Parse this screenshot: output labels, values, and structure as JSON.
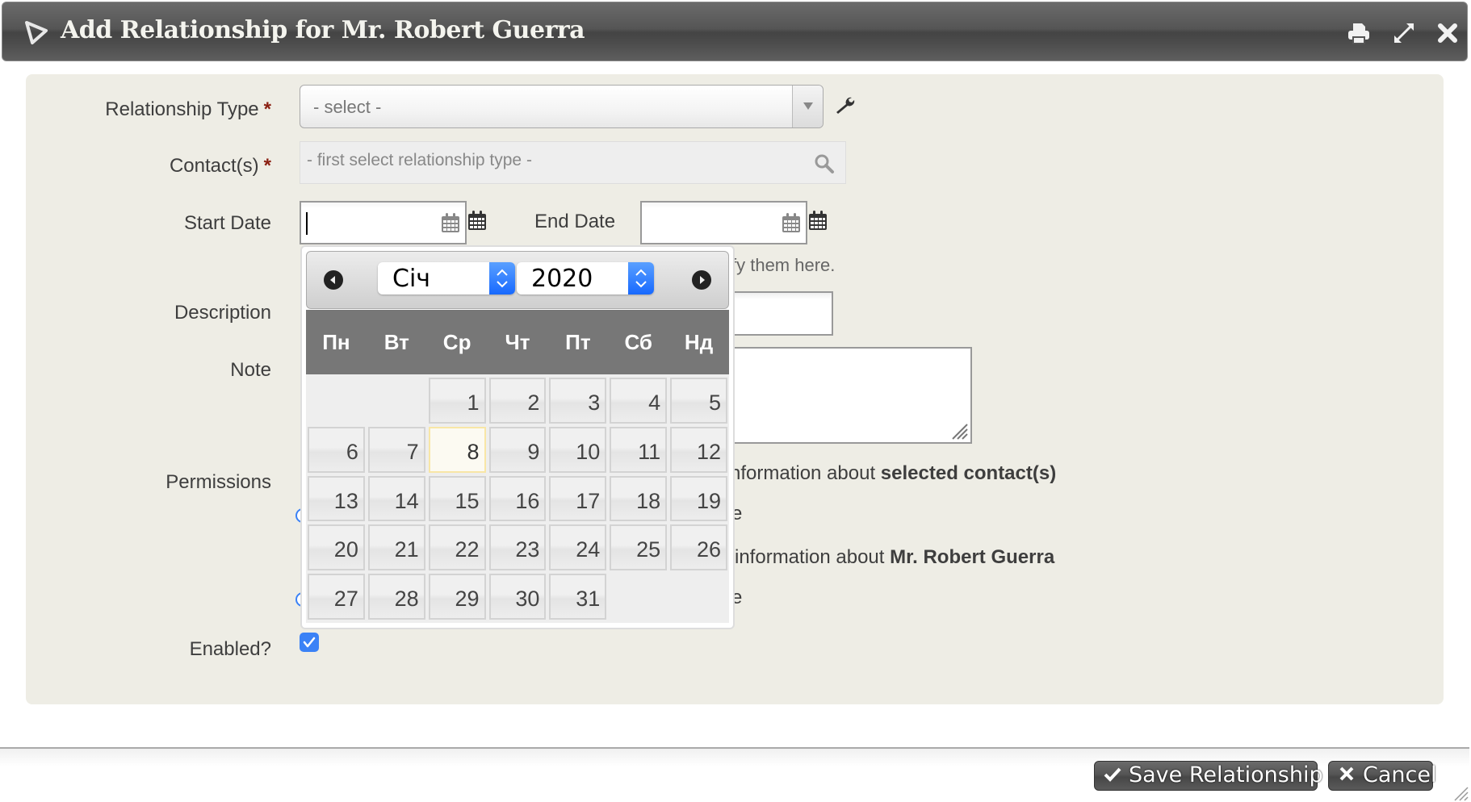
{
  "dialog": {
    "title": "Add Relationship for Mr. Robert Guerra",
    "icons": [
      "triangle-logo-icon",
      "printer-icon",
      "maximize-icon",
      "close-icon"
    ]
  },
  "form": {
    "relationship_type": {
      "label": "Relationship Type",
      "required_mark": "*",
      "placeholder": "- select -"
    },
    "contacts": {
      "label": "Contact(s)",
      "required_mark": "*",
      "placeholder": "- first select relationship type -"
    },
    "start_date": {
      "label": "Start Date",
      "value": ""
    },
    "end_date": {
      "label": "End Date",
      "value": ""
    },
    "help_text_visible": "fy them here.",
    "description": {
      "label": "Description",
      "value": ""
    },
    "note": {
      "label": "Note",
      "value": ""
    },
    "permissions": {
      "label": "Permissions",
      "line1_prefix": "nformation about ",
      "line1_bold": "selected contact(s)",
      "line1_option_tail": "e",
      "line2_prefix": "information about ",
      "line2_bold": "Mr. Robert Guerra",
      "line2_option_tail": "e"
    },
    "enabled": {
      "label": "Enabled?",
      "checked": true
    }
  },
  "datepicker": {
    "month": "Січ",
    "year": "2020",
    "weekdays": [
      "Пн",
      "Вт",
      "Ср",
      "Чт",
      "Пт",
      "Сб",
      "Нд"
    ],
    "leading_blanks": 2,
    "days": [
      "1",
      "2",
      "3",
      "4",
      "5",
      "6",
      "7",
      "8",
      "9",
      "10",
      "11",
      "12",
      "13",
      "14",
      "15",
      "16",
      "17",
      "18",
      "19",
      "20",
      "21",
      "22",
      "23",
      "24",
      "25",
      "26",
      "27",
      "28",
      "29",
      "30",
      "31"
    ],
    "highlighted_day": "8"
  },
  "footer": {
    "save_label": "Save Relationship",
    "cancel_label": "Cancel"
  }
}
